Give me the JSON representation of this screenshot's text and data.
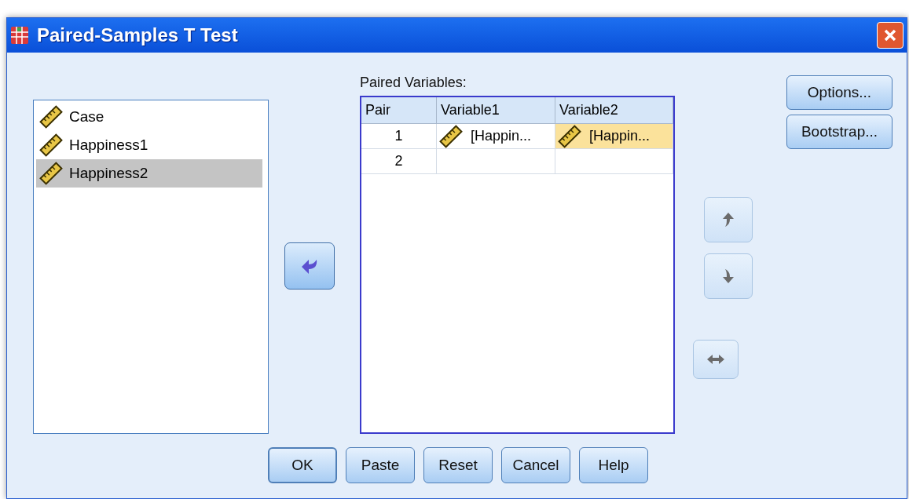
{
  "window": {
    "title": "Paired-Samples T Test"
  },
  "source_list": [
    {
      "name": "Case",
      "selected": false
    },
    {
      "name": "Happiness1",
      "selected": false
    },
    {
      "name": "Happiness2",
      "selected": true
    }
  ],
  "move_button": {
    "kind": "left",
    "disabled": false
  },
  "paired_variables": {
    "label": "Paired Variables:",
    "columns": [
      "Pair",
      "Variable1",
      "Variable2"
    ],
    "rows": [
      {
        "pair": "1",
        "cells": [
          {
            "text": "[Happin...",
            "selected": false
          },
          {
            "text": "[Happin...",
            "selected": true
          }
        ]
      },
      {
        "pair": "2",
        "cells": [
          {
            "selected": false
          },
          {
            "selected": false
          }
        ]
      }
    ]
  },
  "order_buttons": [
    {
      "kind": "up",
      "disabled": true
    },
    {
      "kind": "down",
      "disabled": true
    },
    {
      "kind": "swap",
      "disabled": true
    }
  ],
  "side_buttons": [
    "Options...",
    "Bootstrap..."
  ],
  "footer_buttons": [
    {
      "label": "OK",
      "default": true
    },
    {
      "label": "Paste",
      "default": false
    },
    {
      "label": "Reset",
      "default": false
    },
    {
      "label": "Cancel",
      "default": false
    },
    {
      "label": "Help",
      "default": false
    }
  ]
}
